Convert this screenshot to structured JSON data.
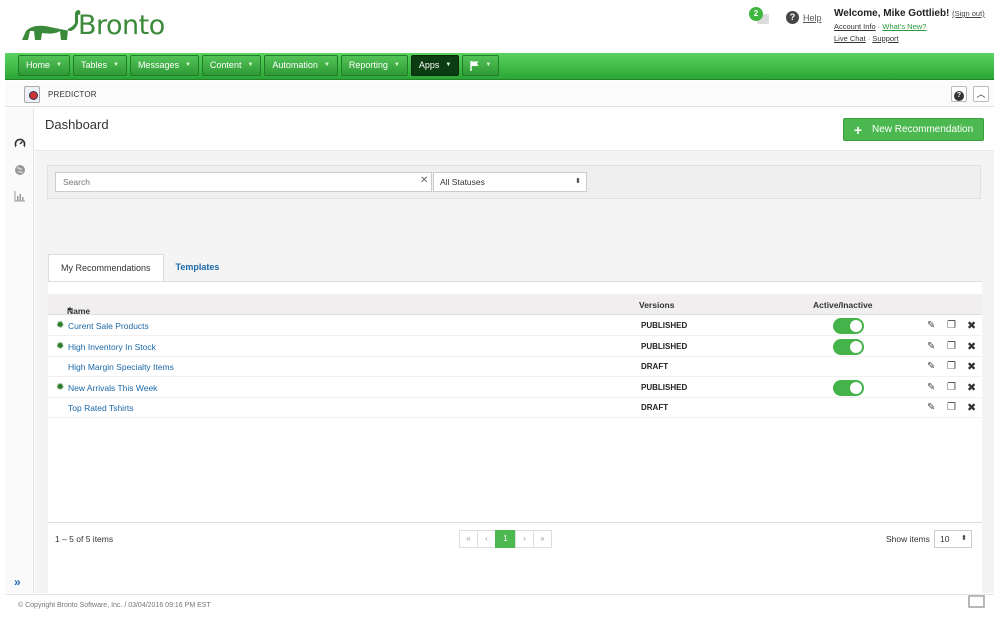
{
  "brand": {
    "name": "Bronto",
    "color": "#3b8a3b"
  },
  "header": {
    "notification_count": "2",
    "help_label": "Help",
    "welcome": "Welcome, Mike Gottlieb!",
    "sign_out": "(Sign out)",
    "account_info": "Account Info",
    "whats_new": "What's New?",
    "live_chat": "Live Chat",
    "support": "Support",
    "sep": "·"
  },
  "nav": {
    "items": [
      {
        "label": "Home"
      },
      {
        "label": "Tables"
      },
      {
        "label": "Messages"
      },
      {
        "label": "Content"
      },
      {
        "label": "Automation"
      },
      {
        "label": "Reporting"
      },
      {
        "label": "Apps",
        "active": true
      }
    ],
    "flag_icon": "flag-icon"
  },
  "subheader": {
    "title": "PREDICTOR"
  },
  "main": {
    "title": "Dashboard",
    "new_button": "New Recommendation",
    "search_placeholder": "Search",
    "status_filter": "All Statuses",
    "tabs": [
      {
        "label": "My Recommendations",
        "active": true
      },
      {
        "label": "Templates"
      }
    ],
    "table": {
      "columns": {
        "name": "Name",
        "sort_indicator": "▲",
        "versions": "Versions",
        "active": "Active/Inactive"
      },
      "rows": [
        {
          "name": "Curent Sale Products",
          "version": "PUBLISHED",
          "gear": true,
          "active": true
        },
        {
          "name": "High Inventory In Stock",
          "version": "PUBLISHED",
          "gear": true,
          "active": true
        },
        {
          "name": "High Margin Specialty Items",
          "version": "DRAFT",
          "gear": false,
          "active": null
        },
        {
          "name": "New Arrivals This Week",
          "version": "PUBLISHED",
          "gear": true,
          "active": true
        },
        {
          "name": "Top Rated Tshirts",
          "version": "DRAFT",
          "gear": false,
          "active": null
        }
      ]
    },
    "pagination": {
      "summary": "1 – 5 of 5 items",
      "first": "«",
      "prev": "‹",
      "current": "1",
      "next": "›",
      "last": "»",
      "show_items_label": "Show items",
      "per_page": "10"
    }
  },
  "footer": {
    "copyright": "© Copyright Bronto Software, Inc.  /  03/04/2016 09:16 PM EST"
  },
  "colors": {
    "accent_green": "#4cb850",
    "nav_green": "#2ca536",
    "link_blue": "#1b68a8"
  }
}
